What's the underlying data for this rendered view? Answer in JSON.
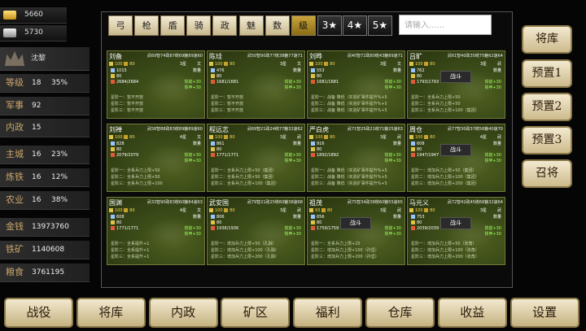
{
  "resources": {
    "gold": "5660",
    "silver": "5730"
  },
  "owner": "沈黎",
  "stats": [
    {
      "label": "等级",
      "v1": "18",
      "v2": "35%"
    },
    {
      "label": "军事",
      "v1": "92",
      "v2": ""
    },
    {
      "label": "内政",
      "v1": "15",
      "v2": ""
    },
    {
      "label": "主城",
      "v1": "16",
      "v2": "23%"
    },
    {
      "label": "炼铁",
      "v1": "16",
      "v2": "12%"
    },
    {
      "label": "农业",
      "v1": "16",
      "v2": "38%"
    },
    {
      "label": "金钱",
      "v1": "13973760",
      "v2": ""
    },
    {
      "label": "铁矿",
      "v1": "1140608",
      "v2": ""
    },
    {
      "label": "粮食",
      "v1": "3761195",
      "v2": ""
    }
  ],
  "filters": [
    "弓",
    "枪",
    "盾",
    "骑",
    "政",
    "魅",
    "数",
    "级"
  ],
  "star_filters": [
    "3★",
    "4★",
    "5★"
  ],
  "search_placeholder": "请输入......",
  "side_buttons": [
    "将库",
    "预置1",
    "预置2",
    "预置3",
    "召将"
  ],
  "bottom_nav": [
    "战役",
    "将库",
    "内政",
    "矿区",
    "福利",
    "仓库",
    "收益",
    "设置"
  ],
  "cards": [
    {
      "name": "刘备",
      "stats": "武69智74政87统69魅89速60",
      "lv": "100",
      "rank": "80",
      "stars": "3星",
      "type": "文",
      "qty": "数量",
      "r1": "1015",
      "r2": "80",
      "r3": "2684/2684",
      "bonus": [
        "铁锭+30",
        "铁甲+30"
      ],
      "skills": [
        "星阶一：暂不开放",
        "星阶二：暂不开放",
        "星阶三：暂不开放"
      ],
      "fight": ""
    },
    {
      "name": "陈珪",
      "stats": "武50智90政77统38魅77速71",
      "lv": "100",
      "rank": "80",
      "stars": "3星",
      "type": "文",
      "qty": "数量",
      "r1": "476",
      "r2": "80",
      "r3": "1681/1681",
      "bonus": [
        "铁锭+30",
        "铁甲+30"
      ],
      "skills": [
        "星阶一：暂不开放",
        "星阶二：暂不开放",
        "星阶三：暂不开放"
      ],
      "fight": ""
    },
    {
      "name": "刘晔",
      "stats": "武40智72政80统43魅89速71",
      "lv": "100",
      "rank": "80",
      "stars": "3星",
      "type": "文",
      "qty": "数量",
      "r1": "553",
      "r2": "80",
      "r3": "1681/1681",
      "bonus": [
        "铁锭+30",
        "铁甲+30"
      ],
      "skills": [
        "星阶一：战备 降低（实验矿事件提升%+5",
        "星阶二：战备 降低（实验矿事件提升%+5",
        "星阶三：战备 降低（实验矿事件提升%+5"
      ],
      "fight": ""
    },
    {
      "name": "吕旷",
      "stats": "武61智40政35统75魅62速64",
      "lv": "100",
      "rank": "80",
      "stars": "3星",
      "type": "武",
      "qty": "数量",
      "r1": "762",
      "r2": "80",
      "r3": "1793/1793",
      "bonus": [
        "铁锭+30",
        "铁甲+30"
      ],
      "skills": [
        "星阶一：全系兵力上限+50",
        "星阶二：全系兵力上限+50",
        "星阶三：全系兵力上限+100（集团）"
      ],
      "fight": "战斗"
    },
    {
      "name": "刘禅",
      "stats": "武58智88政83统89魅89速60",
      "lv": "100",
      "rank": "80",
      "stars": "4星",
      "type": "文",
      "qty": "数量",
      "r1": "828",
      "r2": "80",
      "r3": "2079/2079",
      "bonus": [
        "铁锭+30",
        "铁甲+30"
      ],
      "skills": [
        "星阶一：全系兵力上限+50",
        "星阶二：全系兵力上限+50",
        "星阶三：全系兵力上限+100"
      ],
      "fight": ""
    },
    {
      "name": "程远志",
      "stats": "武69智21政24统77魅32速62",
      "lv": "100",
      "rank": "80",
      "stars": "3星",
      "type": "武",
      "qty": "数量",
      "r1": "861",
      "r2": "80",
      "r3": "1771/1771",
      "bonus": [
        "铁锭+30",
        "铁甲+30"
      ],
      "skills": [
        "星阶一：全系兵力上限+50（集团）",
        "星阶二：全系兵力上限+50（集团）",
        "星阶三：全系兵力上限+100（集团）"
      ],
      "fight": ""
    },
    {
      "name": "严白虎",
      "stats": "武71智25政21统71魅25速63",
      "lv": "100",
      "rank": "80",
      "stars": "3星",
      "type": "武",
      "qty": "数量",
      "r1": "916",
      "r2": "80",
      "r3": "1892/1892",
      "bonus": [
        "铁锭+30",
        "铁甲+30"
      ],
      "skills": [
        "星阶一：战备 降低（实验矿事件提升%+5",
        "星阶二：战备 降低（实验矿事件提升%+5",
        "星阶三：战备 降低（实验矿事件提升%+5"
      ],
      "fight": ""
    },
    {
      "name": "周仓",
      "stats": "武77智30政37统56魅40速70",
      "lv": "100",
      "rank": "80",
      "stars": "4星",
      "type": "武",
      "qty": "数量",
      "r1": "608",
      "r2": "80",
      "r3": "1947/1947",
      "bonus": [
        "铁锭+30",
        "铁甲+30"
      ],
      "skills": [
        "星阶一：增加兵力上限+50（集团）",
        "星阶二：增加兵力上限+100（集团）",
        "星阶三：增加兵力上限+200（集团）"
      ],
      "fight": "战斗"
    },
    {
      "name": "国渊",
      "stats": "武33智90政83统60魅84速63",
      "lv": "100",
      "rank": "80",
      "stars": "4星",
      "type": "文",
      "qty": "数量",
      "r1": "608",
      "r2": "80",
      "r3": "1771/1771",
      "bonus": [
        "铁锭+30",
        "铁甲+30"
      ],
      "skills": [
        "星阶一：全系提升+1",
        "星阶二：全系提升+1",
        "星阶三：全系提升+1"
      ],
      "fight": ""
    },
    {
      "name": "武安国",
      "stats": "武79智21政25统60魅38速68",
      "lv": "100",
      "rank": "80",
      "stars": "3星",
      "type": "武",
      "qty": "数量",
      "r1": "806",
      "r2": "80",
      "r3": "1936/1936",
      "bonus": [
        "铁锭+30",
        "铁甲+30"
      ],
      "skills": [
        "星阶一：增加兵力上限+50（孔融）",
        "星阶二：增加兵力上限+100（孔融）",
        "星阶三：增加兵力上限+200（孔融）"
      ],
      "fight": ""
    },
    {
      "name": "祖茂",
      "stats": "武75智34政38统60魅55速65",
      "lv": "93",
      "rank": "80",
      "stars": "3星",
      "type": "武",
      "qty": "数量",
      "r1": "656",
      "r2": "80",
      "r3": "1759/1759",
      "bonus": [
        "铁锭+30",
        "铁甲+30"
      ],
      "skills": [
        "星阶一：全系兵力上限+25",
        "星阶二：增加兵力上限+100（孙坚）",
        "星阶三：增加兵力上限+200（孙坚）"
      ],
      "fight": "战斗"
    },
    {
      "name": "马元义",
      "stats": "武72智42政45统66魅32速64",
      "lv": "100",
      "rank": "80",
      "stars": "3星",
      "type": "武",
      "qty": "数量",
      "r1": "753",
      "r2": "80",
      "r3": "2039/2039",
      "bonus": [
        "铁锭+30",
        "铁甲+30"
      ],
      "skills": [
        "星阶一：增加兵力上限+50（张角）",
        "星阶二：增加兵力上限+100（张角）",
        "星阶三：增加兵力上限+200（张角）"
      ],
      "fight": "战斗"
    }
  ]
}
